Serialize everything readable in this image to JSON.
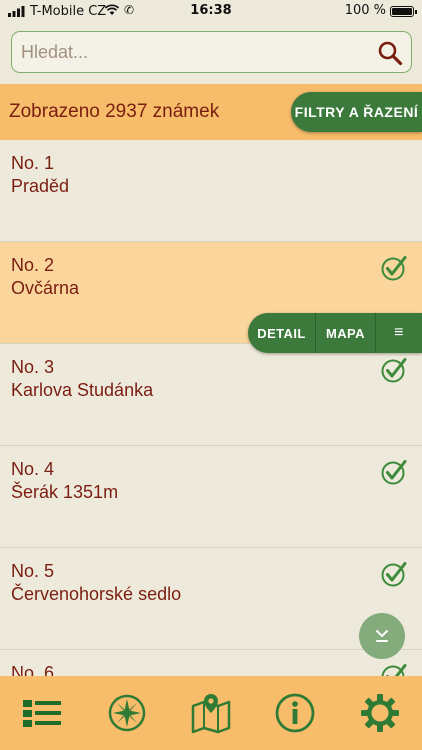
{
  "status_bar": {
    "carrier": "T-Mobile CZ",
    "time": "16:38",
    "battery": "100 %"
  },
  "search": {
    "placeholder": "Hledat...",
    "value": ""
  },
  "filter": {
    "count_text": "Zobrazeno 2937 známek",
    "button_label": "FILTRY A ŘAZENÍ"
  },
  "list": {
    "items": [
      {
        "number": "No. 1",
        "name": "Praděd",
        "checked": false
      },
      {
        "number": "No. 2",
        "name": "Ovčárna",
        "checked": true
      },
      {
        "number": "No. 3",
        "name": "Karlova Studánka",
        "checked": true
      },
      {
        "number": "No. 4",
        "name": "Šerák 1351m",
        "checked": true
      },
      {
        "number": "No. 5",
        "name": "Červenohorské sedlo",
        "checked": true
      },
      {
        "number": "No. 6",
        "name": "",
        "checked": true
      }
    ]
  },
  "actions": {
    "detail": "DETAIL",
    "map": "MAPA",
    "menu": "≡"
  },
  "colors": {
    "accent_green": "#3c7a3b",
    "orange_bar": "#f7bd6b",
    "selected_row": "#fbd69c",
    "text": "#7a1e12",
    "background": "#eeeadb"
  },
  "tabs": [
    {
      "icon": "list-icon"
    },
    {
      "icon": "compass-icon"
    },
    {
      "icon": "map-icon"
    },
    {
      "icon": "info-icon"
    },
    {
      "icon": "settings-gear-icon"
    }
  ]
}
